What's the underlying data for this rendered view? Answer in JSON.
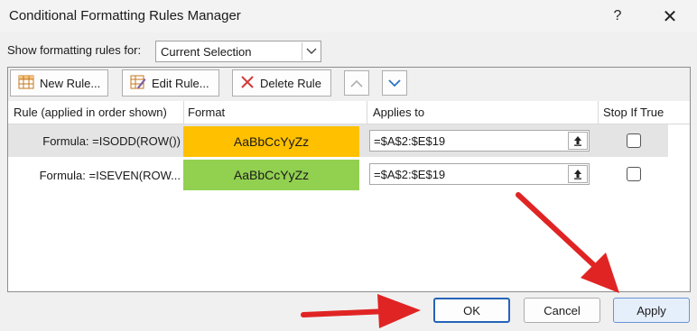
{
  "window": {
    "title": "Conditional Formatting Rules Manager",
    "help_label": "?",
    "close_label": "✕"
  },
  "show_rules": {
    "label": "Show formatting rules for:",
    "selected": "Current Selection"
  },
  "toolbar": {
    "new_rule": "New Rule...",
    "edit_rule": "Edit Rule...",
    "delete_rule": "Delete Rule"
  },
  "columns": {
    "rule": "Rule (applied in order shown)",
    "format": "Format",
    "applies_to": "Applies to",
    "stop_if_true": "Stop If True"
  },
  "rules": [
    {
      "formula": "Formula: =ISODD(ROW())",
      "preview": "AaBbCcYyZz",
      "applies_to": "=$A$2:$E$19",
      "stop_if_true": false,
      "color": "#ffc000",
      "selected": true
    },
    {
      "formula": "Formula: =ISEVEN(ROW...",
      "preview": "AaBbCcYyZz",
      "applies_to": "=$A$2:$E$19",
      "stop_if_true": false,
      "color": "#92d050",
      "selected": false
    }
  ],
  "footer": {
    "ok": "OK",
    "cancel": "Cancel",
    "apply": "Apply"
  },
  "colors": {
    "accent": "#2563b8",
    "annotation_arrow": "#e02424"
  }
}
